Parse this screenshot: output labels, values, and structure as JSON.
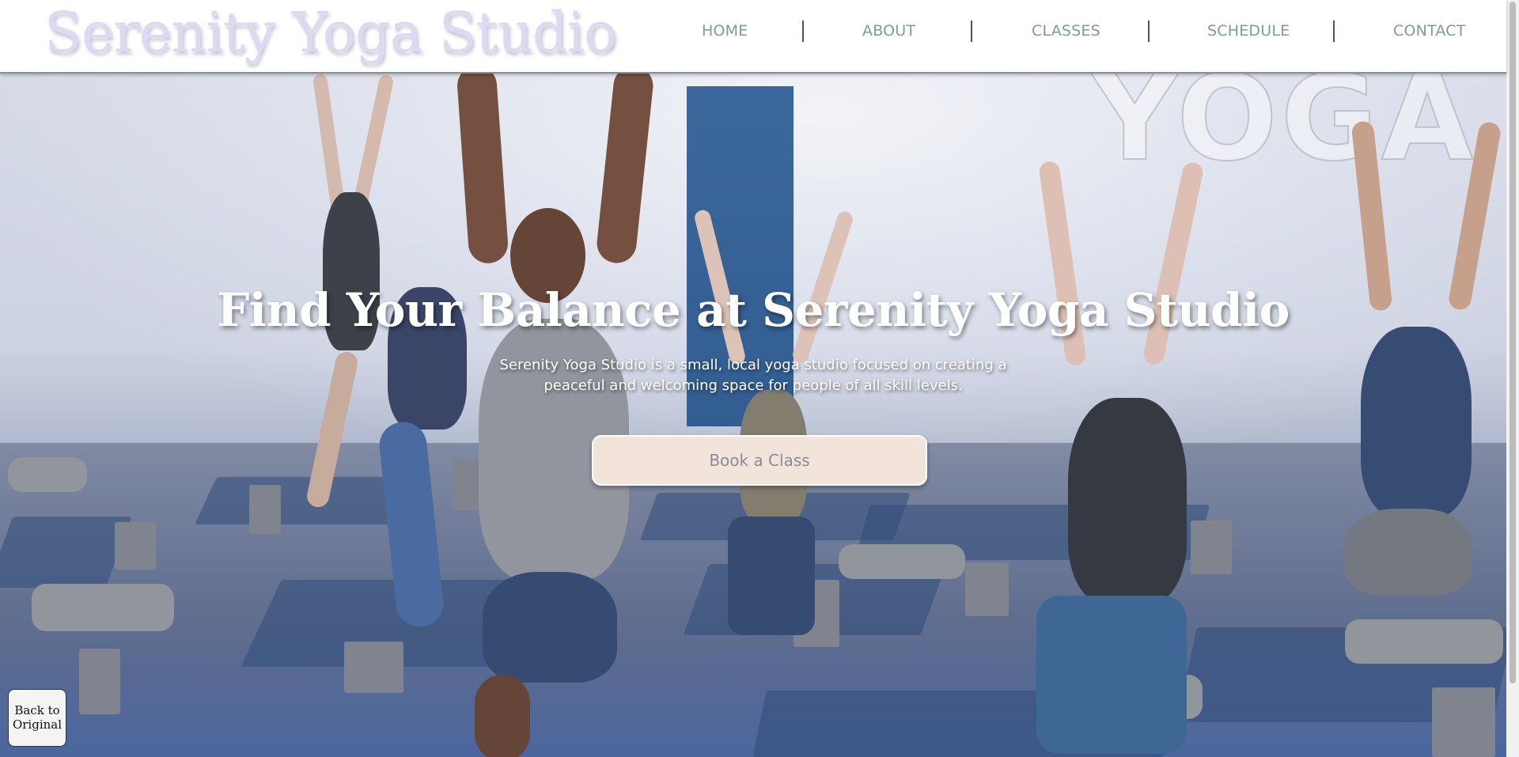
{
  "header": {
    "logo": "Serenity Yoga Studio",
    "nav": [
      {
        "label": "HOME"
      },
      {
        "label": "ABOUT"
      },
      {
        "label": "CLASSES"
      },
      {
        "label": "SCHEDULE"
      },
      {
        "label": "CONTACT"
      }
    ]
  },
  "hero": {
    "title": "Find Your Balance at Serenity Yoga Studio",
    "subtitle": "Serenity Yoga Studio is a small, local yoga studio focused on creating a peaceful and welcoming space for people of all skill levels.",
    "cta": "Book a Class",
    "wall_text": "YOGA"
  },
  "floating": {
    "back_label": "Back to Original"
  },
  "colors": {
    "nav_text": "#7e9b97",
    "logo": "#dcdaf0",
    "cta_bg": "#f3e4db"
  }
}
